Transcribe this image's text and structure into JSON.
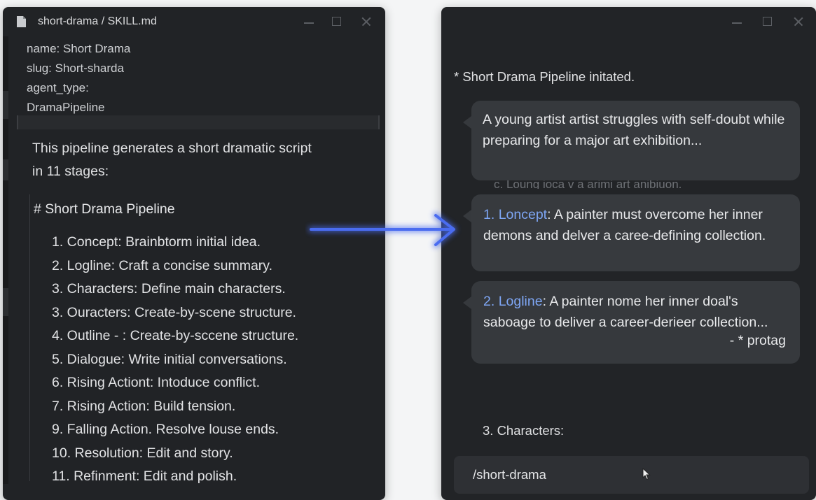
{
  "editor": {
    "title": "short-drama / SKILL.md",
    "frontmatter": [
      "name: Short Drama",
      "slug: Short-sharda",
      "agent_type:",
      "DramaPipeline"
    ],
    "description": [
      "This pipeline generates a short dramatic script",
      "in 11 stages:"
    ],
    "pipeline_heading": "# Short Drama Pipeline",
    "steps": [
      "1.  Concept: Brainbtorm initial idea.",
      "2.   Logline: Craft a concise summary.",
      "3. Characters: Define main characters.",
      "3. Ouracters: Create-by-scene structure.",
      "4. Outline - : Create-by-sccene structure.",
      "5. Dialogue: Write initial conversations.",
      "6. Rising Actiont: Intoduce conflict.",
      "7. Rising Action: Build tension.",
      "9. Falling Action. Resolve louse ends.",
      "10. Resolution: Edit and story.",
      "11. Refinment: Edit and polish."
    ]
  },
  "chat": {
    "system_line": "* Short Drama Pipeline initated.",
    "messages": [
      {
        "number": "",
        "label": "",
        "text": "A young artist artist struggles with self-doubt while preparing for a major art exhibition...",
        "tag": ""
      },
      {
        "number": "1.",
        "label": "Loncept",
        "text": ": A painter must overcome her inner demons and delver a caree-defining collection.",
        "tag": ""
      },
      {
        "number": "2.",
        "label": "Logline",
        "text": ": A painter nome her inner doal's saboage to deliver a career-derieer collection...",
        "tag": "- * protag"
      }
    ],
    "ghost_text": "c. Loung ioca v a arimi art anibiuon.",
    "section_3": "3. Characters:",
    "command_input": "/short-drama"
  },
  "colors": {
    "accent_blue": "#7ea6f4",
    "arrow": "#4a6cf0"
  }
}
